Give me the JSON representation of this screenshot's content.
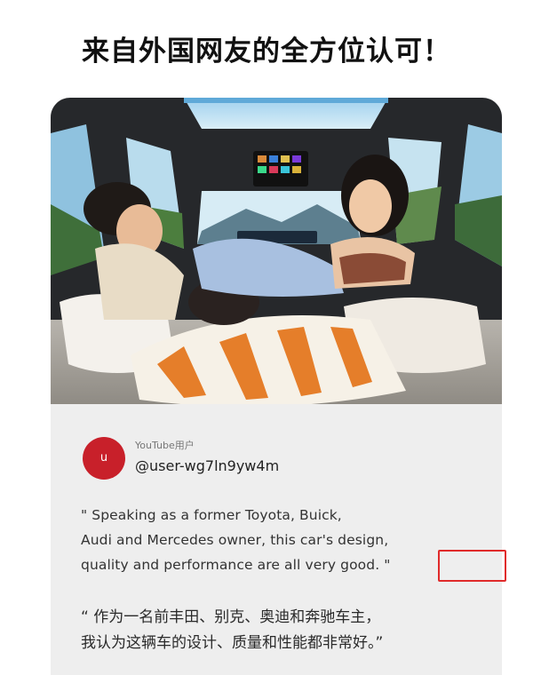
{
  "headline": "来自外国网友的全方位认可！",
  "colors": {
    "accent": "#c8202a",
    "highlight": "#e02a2a"
  },
  "comment": {
    "avatar_letter": "u",
    "source_label": "YouTube用户",
    "username": "@user-wg7ln9yw4m",
    "quote_en": "\" Speaking as a former Toyota, Buick,\n  Audi and Mercedes owner, this car's design,\n  quality and performance are all very good. \"",
    "quote_zh": "“ 作为一名前丰田、别克、奥迪和奔驰车主，\n  我认为这辆车的设计、质量和性能都非常好。”"
  }
}
